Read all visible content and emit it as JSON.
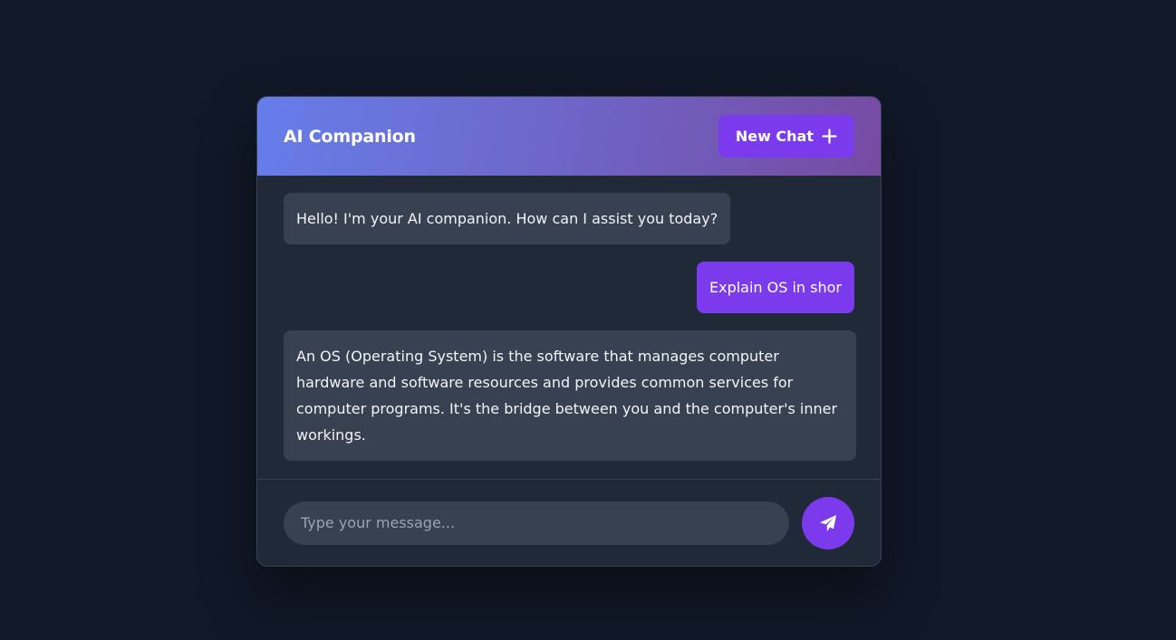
{
  "header": {
    "title": "AI Companion",
    "new_chat_label": "New Chat",
    "gradient_start": "#667eea",
    "gradient_end": "#764ba2"
  },
  "messages": [
    {
      "role": "ai",
      "text": "Hello! I'm your AI companion. How can I assist you today?"
    },
    {
      "role": "user",
      "text": "Explain OS in shor"
    },
    {
      "role": "ai",
      "text": "An OS (Operating System) is the software that manages computer hardware and software resources and provides common services for computer programs. It's the bridge between you and the computer's inner workings."
    }
  ],
  "input": {
    "placeholder": "Type your message...",
    "value": ""
  },
  "icons": {
    "new_chat": "plus-icon",
    "send": "paper-plane-icon"
  },
  "colors": {
    "background": "#111827",
    "panel": "#1f2937",
    "ai_bubble": "#374151",
    "accent": "#7c3aed"
  }
}
